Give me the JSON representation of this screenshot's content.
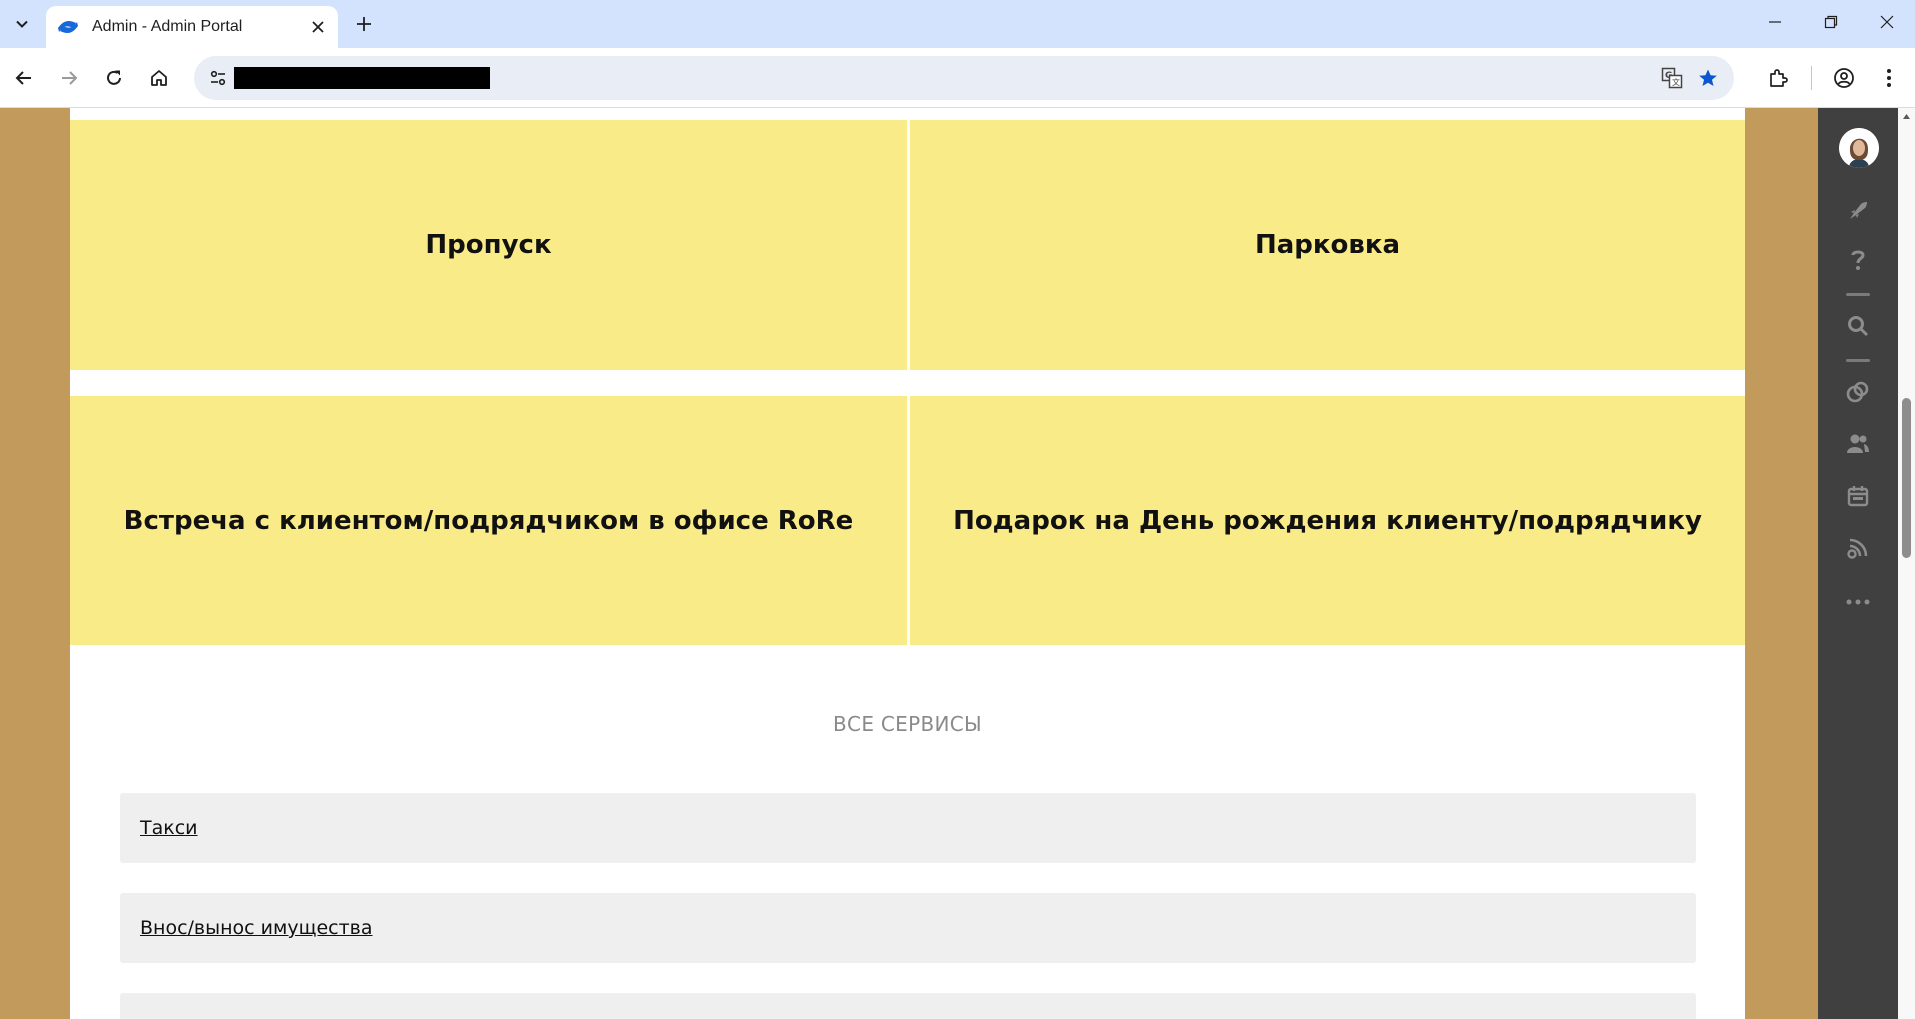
{
  "browser": {
    "tab_title": "Admin - Admin Portal",
    "url": ""
  },
  "tiles": [
    {
      "label": "Пропуск"
    },
    {
      "label": "Парковка"
    },
    {
      "label": "Встреча с клиентом/подрядчиком в офисе RoRe"
    },
    {
      "label": "Подарок на День рождения клиенту/подрядчику"
    }
  ],
  "services": {
    "title": "ВСЕ СЕРВИСЫ",
    "items": [
      {
        "label": "Такси"
      },
      {
        "label": "Внос/вынос имущества"
      },
      {
        "label": ""
      }
    ]
  },
  "rail": {
    "icons": [
      "avatar",
      "rocket-icon",
      "help-icon",
      "search-icon",
      "spaces-icon",
      "people-icon",
      "calendar-icon",
      "feed-icon",
      "more-icon"
    ]
  },
  "colors": {
    "page_background": "#c29a5c",
    "tile_background": "#f9eb88",
    "service_background": "#efefef",
    "rail_background": "#404040",
    "tab_strip": "#d3e3fd"
  }
}
